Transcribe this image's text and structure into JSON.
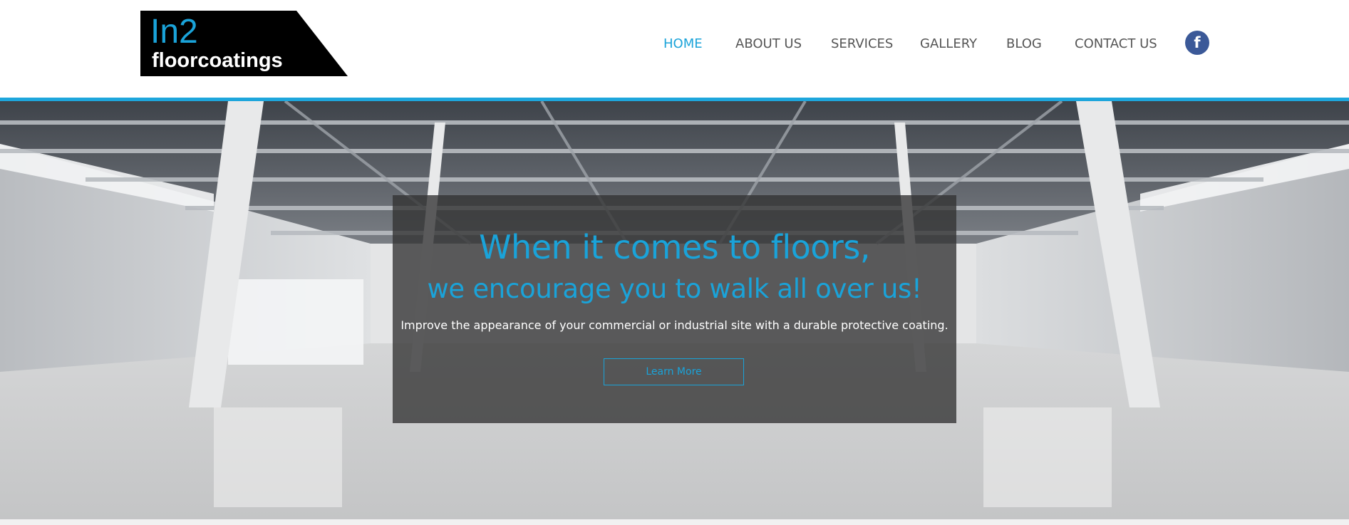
{
  "logo": {
    "line1": "In2",
    "line2": "floorcoatings",
    "bg_color": "#000000",
    "accent_color": "#1aa3d9"
  },
  "nav": {
    "items": [
      {
        "label": "HOME",
        "active": true
      },
      {
        "label": "ABOUT US",
        "active": false
      },
      {
        "label": "SERVICES",
        "active": false
      },
      {
        "label": "GALLERY",
        "active": false
      },
      {
        "label": "BLOG",
        "active": false
      },
      {
        "label": "CONTACT US",
        "active": false
      }
    ],
    "active_color": "#1aa3d9",
    "text_color": "#555555"
  },
  "social": {
    "facebook_icon": "facebook-icon",
    "facebook_glyph": "f",
    "color": "#3b5998"
  },
  "hero": {
    "headline_line1": "When it comes to floors,",
    "headline_line2": "we encourage you to walk all over us!",
    "subtext": "Improve the appearance of your commercial or industrial site with a durable protective coating.",
    "button_label": "Learn More",
    "background": "empty-warehouse-interior-image"
  },
  "colors": {
    "accent": "#1ea6dc",
    "overlay": "rgba(50,50,50,0.78)"
  }
}
